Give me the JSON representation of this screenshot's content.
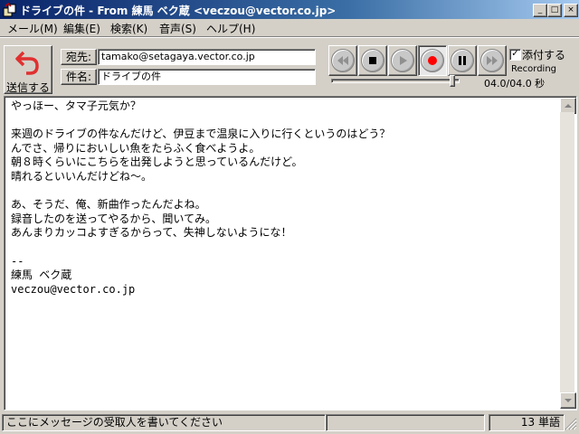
{
  "window": {
    "title": "ドライブの件 - From 練馬 ベク蔵 <veczou@vector.co.jp>",
    "min_glyph": "_",
    "max_glyph": "□",
    "close_glyph": "×"
  },
  "menu": [
    {
      "label": "メール(M)"
    },
    {
      "label": "編集(E)"
    },
    {
      "label": "検索(K)"
    },
    {
      "label": "音声(S)"
    },
    {
      "label": "ヘルプ(H)"
    }
  ],
  "toolbar": {
    "send_label": "送信する",
    "to_label": "宛先:",
    "to_value": "tamako@setagaya.vector.co.jp",
    "subject_label": "件名:",
    "subject_value": "ドライブの件",
    "attach_label": "添付する",
    "attach_checked": "✓",
    "recording_label": "Recording",
    "time_label": "04.0/04.0 秒",
    "recording_level": 0.96
  },
  "body": {
    "text": "やっほー、タマ子元気か？\n\n来週のドライブの件なんだけど、伊豆まで温泉に入りに行くというのはどう？\nんでさ、帰りにおいしい魚をたらふく食べようよ。\n朝８時くらいにこちらを出発しようと思っているんだけど。\n晴れるといいんだけどね～。\n\nあ、そうだ、俺、新曲作ったんだよね。\n録音したのを送ってやるから、聞いてみ。\nあんまりカッコよすぎるからって、失神しないようにな！\n\n--\n練馬 ベク蔵\nveczou@vector.co.jp"
  },
  "status": {
    "message": "ここにメッセージの受取人を書いてください",
    "word_count": "13 単語"
  },
  "colors": {
    "titlebar": "#0a246a",
    "record_red": "#ff0000",
    "send_arrow": "#e03030"
  }
}
